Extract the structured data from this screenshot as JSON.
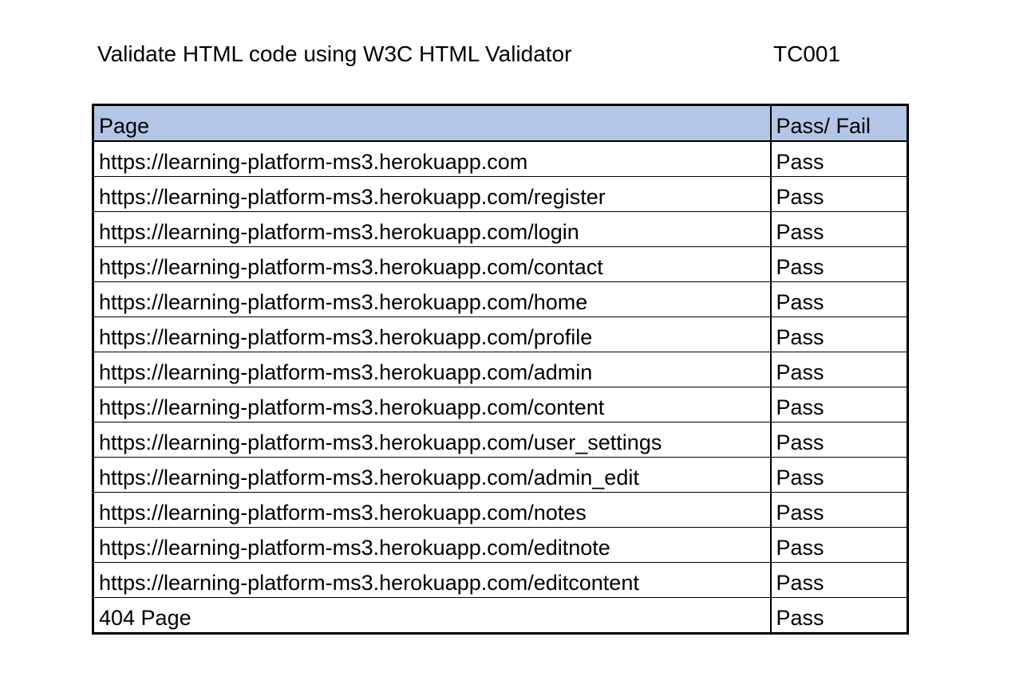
{
  "header": {
    "title": "Validate HTML code using W3C HTML Validator",
    "test_case_id": "TC001"
  },
  "table": {
    "columns": [
      "Page",
      "Pass/ Fail"
    ],
    "header_color": "#b4c6e7",
    "rows": [
      {
        "page": "https://learning-platform-ms3.herokuapp.com",
        "status": "Pass"
      },
      {
        "page": "https://learning-platform-ms3.herokuapp.com/register",
        "status": "Pass"
      },
      {
        "page": "https://learning-platform-ms3.herokuapp.com/login",
        "status": "Pass"
      },
      {
        "page": "https://learning-platform-ms3.herokuapp.com/contact",
        "status": "Pass"
      },
      {
        "page": "https://learning-platform-ms3.herokuapp.com/home",
        "status": "Pass"
      },
      {
        "page": "https://learning-platform-ms3.herokuapp.com/profile",
        "status": "Pass"
      },
      {
        "page": "https://learning-platform-ms3.herokuapp.com/admin",
        "status": "Pass"
      },
      {
        "page": "https://learning-platform-ms3.herokuapp.com/content",
        "status": "Pass"
      },
      {
        "page": "https://learning-platform-ms3.herokuapp.com/user_settings",
        "status": "Pass"
      },
      {
        "page": "https://learning-platform-ms3.herokuapp.com/admin_edit",
        "status": "Pass"
      },
      {
        "page": "https://learning-platform-ms3.herokuapp.com/notes",
        "status": "Pass"
      },
      {
        "page": "https://learning-platform-ms3.herokuapp.com/editnote",
        "status": "Pass"
      },
      {
        "page": "https://learning-platform-ms3.herokuapp.com/editcontent",
        "status": "Pass"
      },
      {
        "page": "404 Page",
        "status": "Pass"
      }
    ]
  }
}
